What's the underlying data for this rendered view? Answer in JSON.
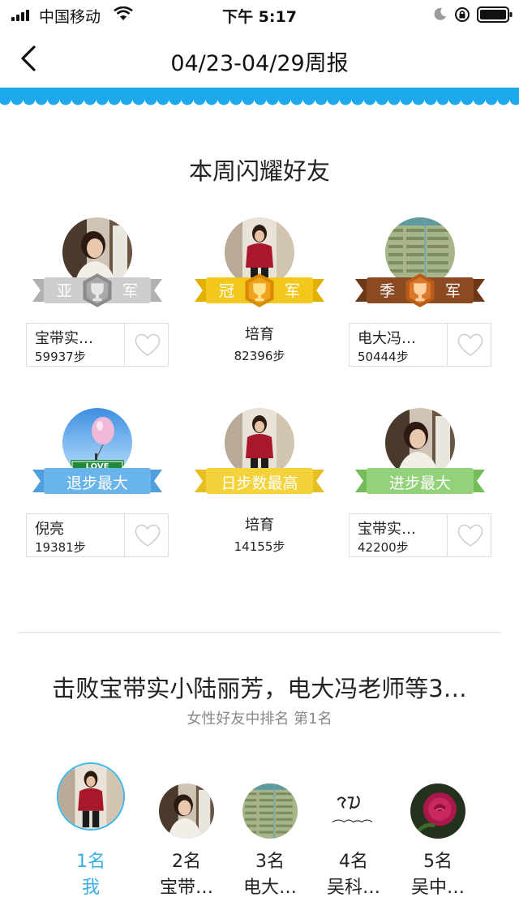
{
  "status_bar": {
    "carrier": "中国移动",
    "time": "下午 5:17"
  },
  "nav": {
    "title": "04/23-04/29周报"
  },
  "section_title": "本周闪耀好友",
  "awards": [
    {
      "ribbon_left": "亚",
      "ribbon_right": "军",
      "name": "宝带实…",
      "steps": "59937步",
      "color": "#c9c9c9",
      "avatar": "woman-window-photo"
    },
    {
      "ribbon_left": "冠",
      "ribbon_right": "军",
      "name": "培育",
      "steps": "82396步",
      "color": "#f2c81c",
      "avatar": "woman-red-jacket-photo"
    },
    {
      "ribbon_left": "季",
      "ribbon_right": "军",
      "name": "电大冯…",
      "steps": "50444步",
      "color": "#8b4a22",
      "avatar": "spreadsheet-photo"
    },
    {
      "ribbon_text": "退步最大",
      "name": "倪亮",
      "steps": "19381步",
      "color": "#6ab4ec",
      "avatar": "love-balloon-photo"
    },
    {
      "ribbon_text": "日步数最高",
      "name": "培育",
      "steps": "14155步",
      "color": "#f3d23c",
      "avatar": "woman-red-jacket-photo"
    },
    {
      "ribbon_text": "进步最大",
      "name": "宝带实…",
      "steps": "42200步",
      "color": "#93d27a",
      "avatar": "woman-window-photo"
    }
  ],
  "defeat_text": "击败宝带实小陆丽芳，电大冯老师等3…",
  "rank_text": "女性好友中排名 第1名",
  "ranking": [
    {
      "rank": "1名",
      "name": "我"
    },
    {
      "rank": "2名",
      "name": "宝带…"
    },
    {
      "rank": "3名",
      "name": "电大…"
    },
    {
      "rank": "4名",
      "name": "吴科…"
    },
    {
      "rank": "5名",
      "name": "吴中…"
    }
  ],
  "colors": {
    "accent": "#3aaee6",
    "wave": "#1ca8ea"
  }
}
